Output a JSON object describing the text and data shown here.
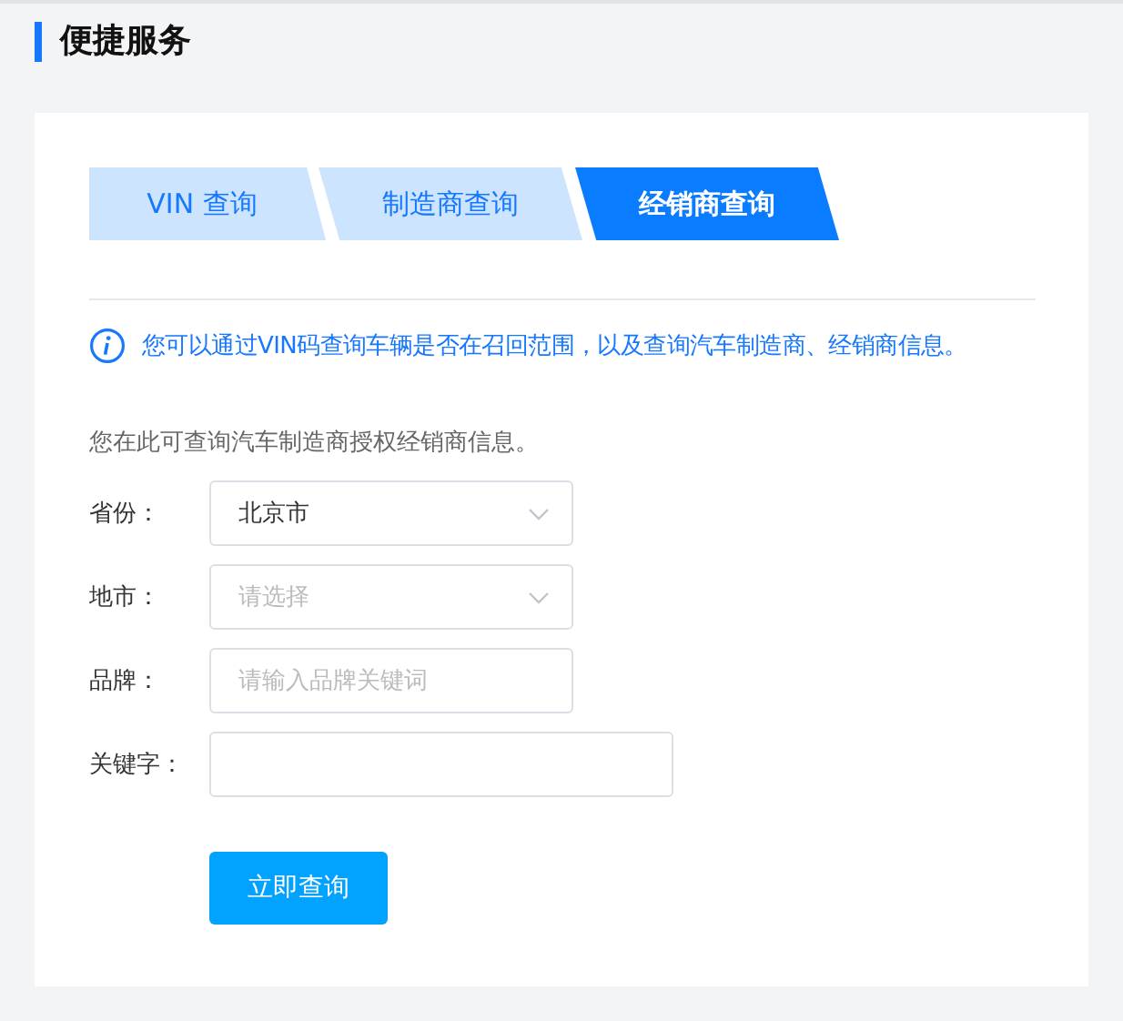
{
  "heading": "便捷服务",
  "tabs": [
    {
      "label": "VIN 查询",
      "selected": false
    },
    {
      "label": "制造商查询",
      "selected": false
    },
    {
      "label": "经销商查询",
      "selected": true
    }
  ],
  "notice": "您可以通过VIN码查询车辆是否在召回范围，以及查询汽车制造商、经销商信息。",
  "intro": "您在此可查询汽车制造商授权经销商信息。",
  "fields": [
    {
      "kind": "select",
      "label": "省份：",
      "value": "北京市"
    },
    {
      "kind": "select",
      "label": "地市：",
      "placeholder": "请选择"
    },
    {
      "kind": "input",
      "label": "品牌：",
      "placeholder": "请输入品牌关键词"
    },
    {
      "kind": "wide",
      "label": "关键字："
    }
  ],
  "submit": "立即查询"
}
